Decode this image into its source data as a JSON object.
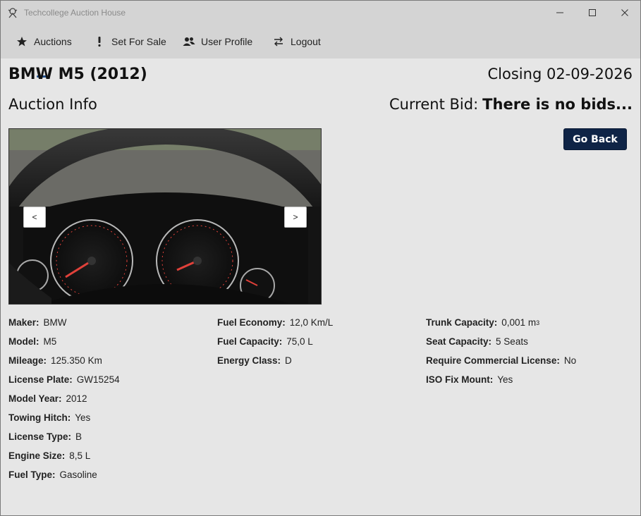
{
  "window": {
    "title": "Techcollege Auction House"
  },
  "nav": {
    "items": [
      {
        "label": "Auctions",
        "icon": "star-icon"
      },
      {
        "label": "Set For Sale",
        "icon": "exclamation-icon"
      },
      {
        "label": "User Profile",
        "icon": "users-icon"
      },
      {
        "label": "Logout",
        "icon": "swap-arrows-icon"
      }
    ],
    "active": "Auctions"
  },
  "auction": {
    "title": "BMW M5 (2012)",
    "closing": "Closing 02-09-2026",
    "section": "Auction Info",
    "bid_label": "Current Bid:",
    "bid_value": "There is no bids...",
    "go_back": "Go Back"
  },
  "carousel": {
    "prev": "<",
    "next": ">"
  },
  "details": {
    "col1": [
      {
        "label": "Maker:",
        "value": "BMW"
      },
      {
        "label": "Model:",
        "value": "M5"
      },
      {
        "label": "Mileage:",
        "value": "125.350 Km"
      },
      {
        "label": "License Plate:",
        "value": "GW15254"
      },
      {
        "label": "Model Year:",
        "value": "2012"
      },
      {
        "label": "Towing Hitch:",
        "value": "Yes"
      },
      {
        "label": "License Type:",
        "value": "B"
      },
      {
        "label": "Engine Size:",
        "value": "8,5 L"
      },
      {
        "label": "Fuel Type:",
        "value": "Gasoline"
      }
    ],
    "col2": [
      {
        "label": "Fuel Economy:",
        "value": "12,0 Km/L"
      },
      {
        "label": "Fuel Capacity:",
        "value": "75,0 L"
      },
      {
        "label": "Energy Class:",
        "value": "D"
      }
    ],
    "col3": [
      {
        "label": "Trunk Capacity:",
        "value": "0,001 m",
        "sup": "3"
      },
      {
        "label": "Seat Capacity:",
        "value": "5 Seats"
      },
      {
        "label": "Require Commercial License:",
        "value": "No"
      },
      {
        "label": "ISO Fix Mount:",
        "value": "Yes"
      }
    ]
  },
  "colors": {
    "nav_active_underline": "#1f4e8c",
    "go_back_bg": "#0f2446",
    "gauge_needle": "#e0413a"
  }
}
